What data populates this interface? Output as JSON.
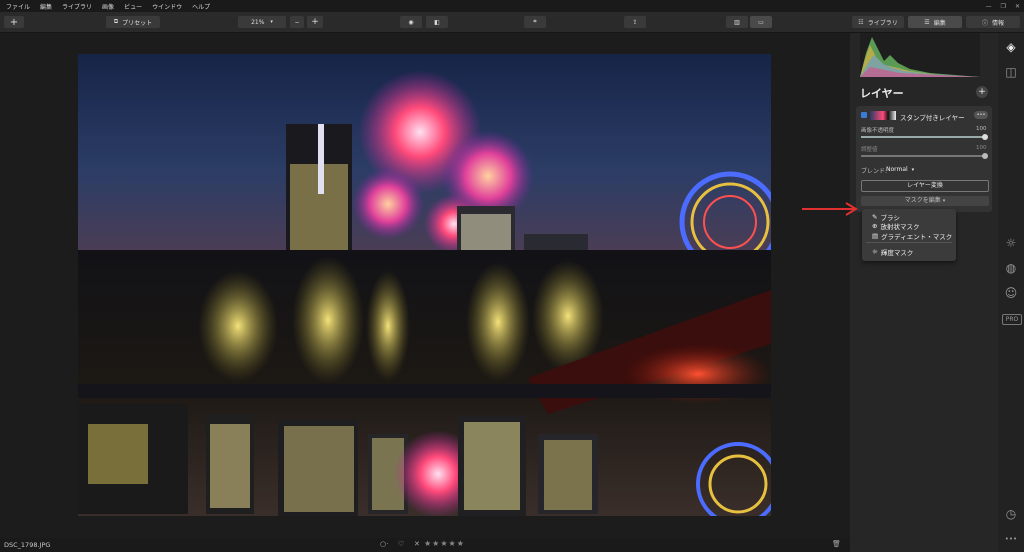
{
  "menu": [
    "ファイル",
    "編集",
    "ライブラリ",
    "画像",
    "ビュー",
    "ウインドウ",
    "ヘルプ"
  ],
  "toolbar": {
    "add": "+",
    "presets": "プリセット",
    "zoom": "21%",
    "zoom_minus": "−",
    "zoom_plus": "+"
  },
  "tabs": {
    "library": "ライブラリ",
    "edit": "編集",
    "info": "情報"
  },
  "layers": {
    "title": "レイヤー",
    "add": "+",
    "layer_name": "スタンプ付きレイヤー",
    "more": "•••",
    "opacity_label": "画像不透明度",
    "opacity_value": "100",
    "adjust_label": "調整値",
    "adjust_value": "100",
    "blend_label": "ブレンド:",
    "blend_value": "Normal",
    "transform_button": "レイヤー変換",
    "mask_button": "マスクを編集"
  },
  "mask_menu": {
    "brush": "ブラシ",
    "radial": "放射状マスク",
    "gradient": "グラディエント・マスク",
    "luminance": "輝度マスク"
  },
  "rail": {
    "pro": "PRO",
    "dots": "•••"
  },
  "status": {
    "filename": "DSC_1798.JPG",
    "stars": "★★★★★",
    "reject": "✕"
  },
  "colors": {
    "accent": "#e03030",
    "card": "#333333",
    "panel": "#262626"
  }
}
